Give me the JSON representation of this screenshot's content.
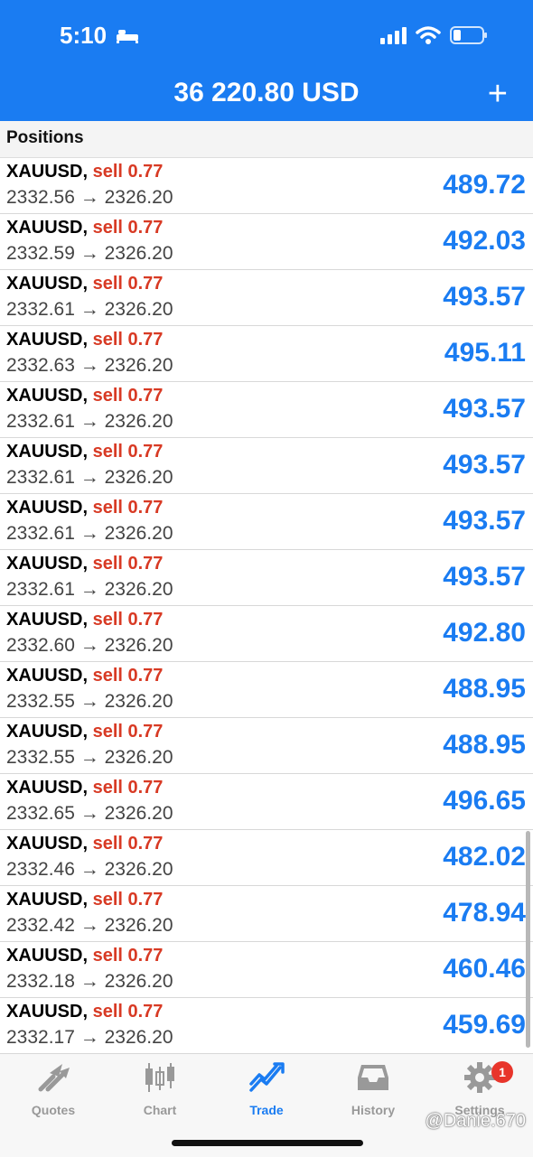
{
  "status_bar": {
    "time": "5:10"
  },
  "header": {
    "balance": "36 220.80 USD",
    "add_label": "+"
  },
  "section": {
    "title": "Positions"
  },
  "positions": [
    {
      "symbol": "XAUUSD,",
      "side": "sell 0.77",
      "open": "2332.56",
      "current": "2326.20",
      "profit": "489.72"
    },
    {
      "symbol": "XAUUSD,",
      "side": "sell 0.77",
      "open": "2332.59",
      "current": "2326.20",
      "profit": "492.03"
    },
    {
      "symbol": "XAUUSD,",
      "side": "sell 0.77",
      "open": "2332.61",
      "current": "2326.20",
      "profit": "493.57"
    },
    {
      "symbol": "XAUUSD,",
      "side": "sell 0.77",
      "open": "2332.63",
      "current": "2326.20",
      "profit": "495.11"
    },
    {
      "symbol": "XAUUSD,",
      "side": "sell 0.77",
      "open": "2332.61",
      "current": "2326.20",
      "profit": "493.57"
    },
    {
      "symbol": "XAUUSD,",
      "side": "sell 0.77",
      "open": "2332.61",
      "current": "2326.20",
      "profit": "493.57"
    },
    {
      "symbol": "XAUUSD,",
      "side": "sell 0.77",
      "open": "2332.61",
      "current": "2326.20",
      "profit": "493.57"
    },
    {
      "symbol": "XAUUSD,",
      "side": "sell 0.77",
      "open": "2332.61",
      "current": "2326.20",
      "profit": "493.57"
    },
    {
      "symbol": "XAUUSD,",
      "side": "sell 0.77",
      "open": "2332.60",
      "current": "2326.20",
      "profit": "492.80"
    },
    {
      "symbol": "XAUUSD,",
      "side": "sell 0.77",
      "open": "2332.55",
      "current": "2326.20",
      "profit": "488.95"
    },
    {
      "symbol": "XAUUSD,",
      "side": "sell 0.77",
      "open": "2332.55",
      "current": "2326.20",
      "profit": "488.95"
    },
    {
      "symbol": "XAUUSD,",
      "side": "sell 0.77",
      "open": "2332.65",
      "current": "2326.20",
      "profit": "496.65"
    },
    {
      "symbol": "XAUUSD,",
      "side": "sell 0.77",
      "open": "2332.46",
      "current": "2326.20",
      "profit": "482.02"
    },
    {
      "symbol": "XAUUSD,",
      "side": "sell 0.77",
      "open": "2332.42",
      "current": "2326.20",
      "profit": "478.94"
    },
    {
      "symbol": "XAUUSD,",
      "side": "sell 0.77",
      "open": "2332.18",
      "current": "2326.20",
      "profit": "460.46"
    },
    {
      "symbol": "XAUUSD,",
      "side": "sell 0.77",
      "open": "2332.17",
      "current": "2326.20",
      "profit": "459.69"
    }
  ],
  "tabs": [
    {
      "label": "Quotes",
      "icon": "quotes-arrows-icon",
      "active": false
    },
    {
      "label": "Chart",
      "icon": "candlestick-icon",
      "active": false
    },
    {
      "label": "Trade",
      "icon": "trend-up-icon",
      "active": true
    },
    {
      "label": "History",
      "icon": "inbox-icon",
      "active": false
    },
    {
      "label": "Settings",
      "icon": "gear-icon",
      "active": false,
      "badge": "1"
    }
  ],
  "colors": {
    "accent": "#1a7cf2",
    "sell": "#d83a24",
    "badge": "#e8352b"
  },
  "watermark": "@Danie.670"
}
